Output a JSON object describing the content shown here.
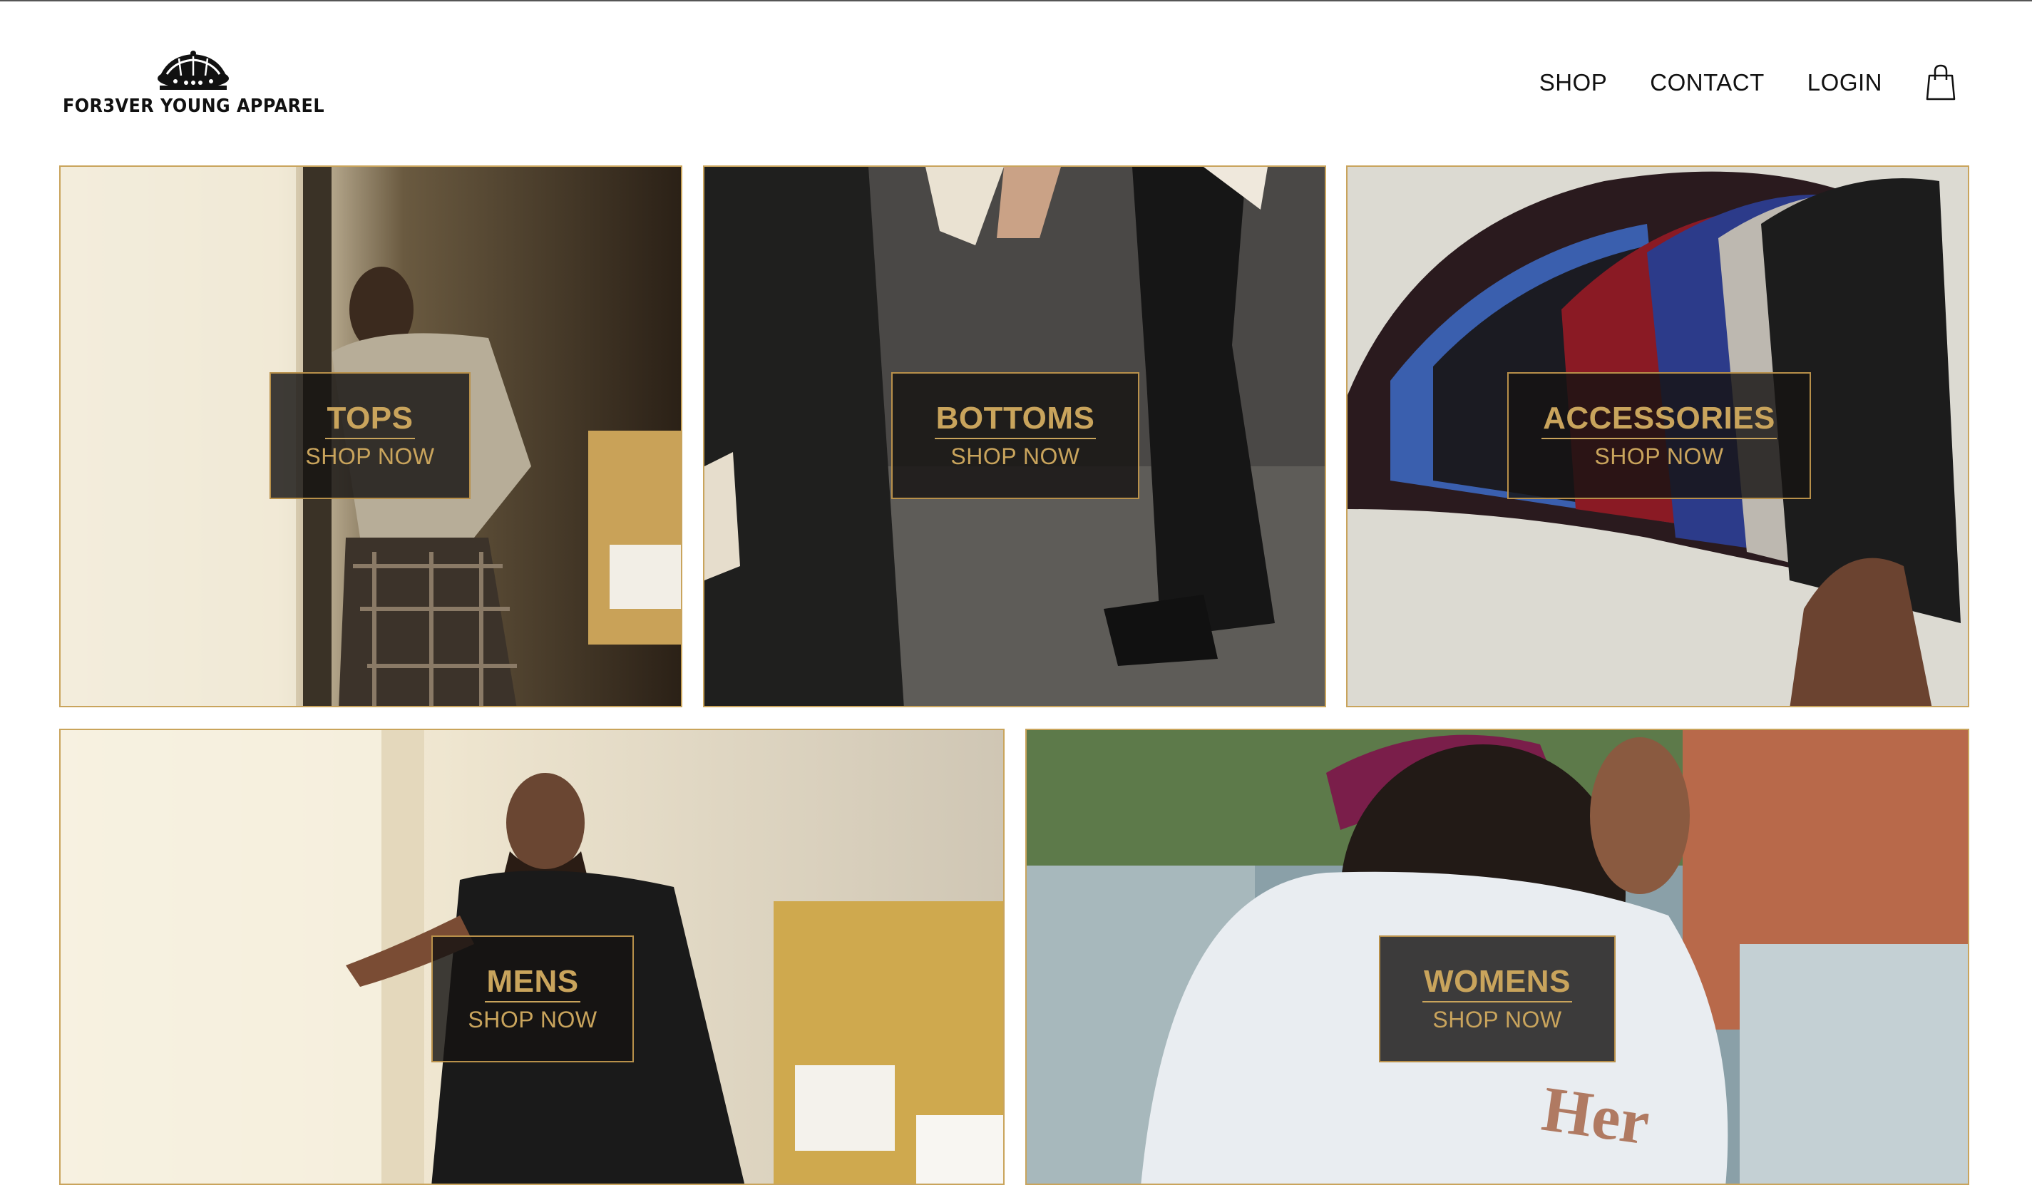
{
  "brand": {
    "name": "FOR3VER YOUNG APPAREL"
  },
  "nav": {
    "shop": "SHOP",
    "contact": "CONTACT",
    "login": "LOGIN"
  },
  "colors": {
    "accent": "#c9a45c",
    "label_bg": "#161412",
    "text": "#111111"
  },
  "tiles": {
    "tops": {
      "title": "TOPS",
      "cta": "SHOP NOW"
    },
    "bottoms": {
      "title": "BOTTOMS",
      "cta": "SHOP NOW"
    },
    "accessories": {
      "title": "ACCESSORIES",
      "cta": "SHOP NOW"
    },
    "mens": {
      "title": "MENS",
      "cta": "SHOP NOW"
    },
    "womens": {
      "title": "WOMENS",
      "cta": "SHOP NOW"
    }
  },
  "icons": {
    "logo": "crown-icon",
    "cart": "shopping-bag-icon"
  }
}
